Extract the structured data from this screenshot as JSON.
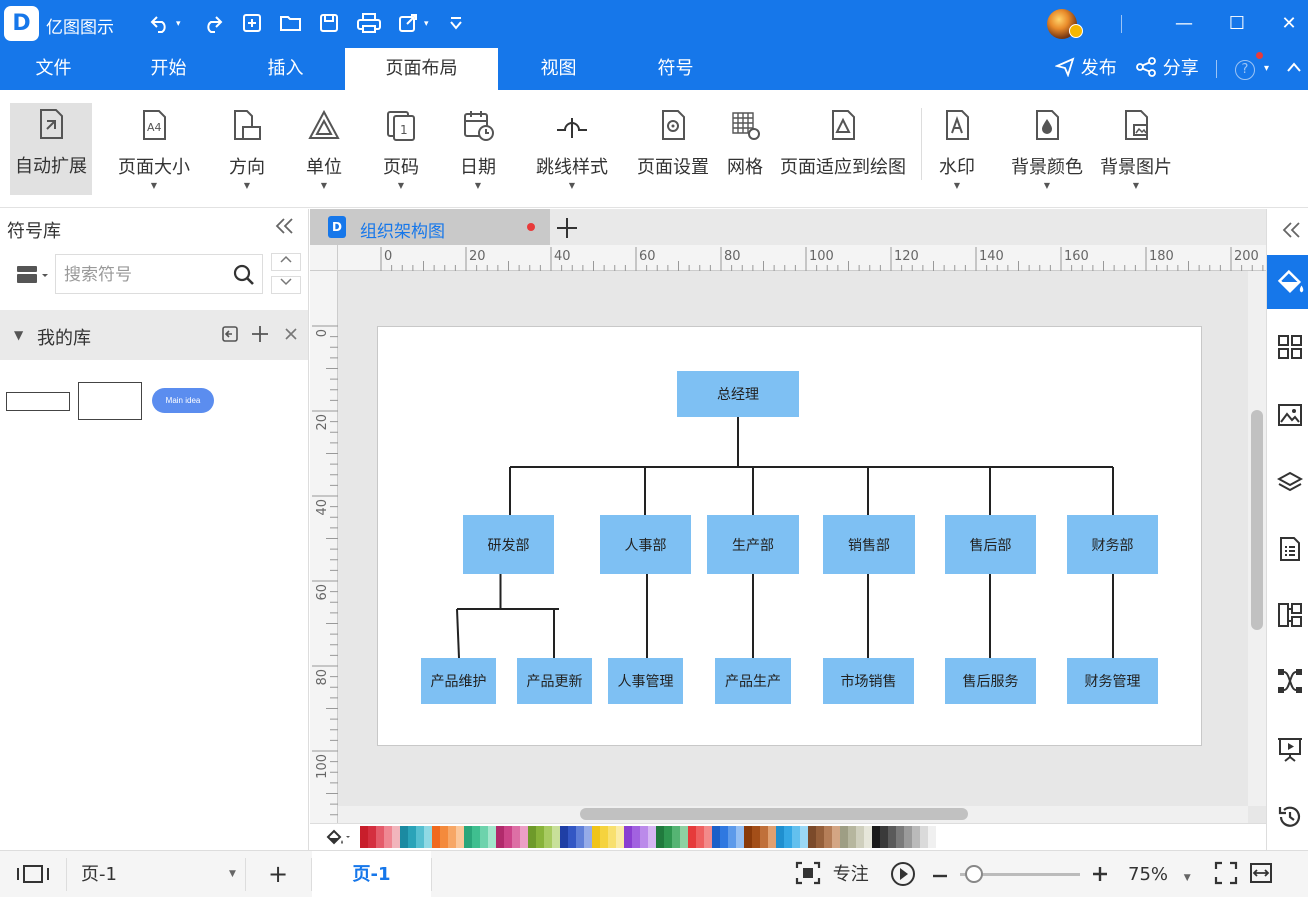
{
  "app": {
    "title": "亿图图示",
    "logo_letter": "D"
  },
  "quick_access": {
    "undo_icon": "undo-icon",
    "redo_icon": "redo-icon",
    "new_icon": "new-file-icon",
    "open_icon": "open-folder-icon",
    "save_icon": "save-icon",
    "print_icon": "print-icon",
    "export_icon": "export-icon",
    "customize_icon": "customize-icon"
  },
  "window": {
    "minimize": "—",
    "maximize": "☐",
    "close": "✕"
  },
  "menu": {
    "tabs": [
      "文件",
      "开始",
      "插入",
      "页面布局",
      "视图",
      "符号"
    ],
    "active_tab": "页面布局",
    "publish": "发布",
    "share": "分享",
    "help": "?"
  },
  "ribbon": {
    "buttons": [
      {
        "label": "自动扩展",
        "icon": "auto-extend-icon",
        "active": true,
        "dropdown": false
      },
      {
        "label": "页面大小",
        "icon": "page-size-icon",
        "dropdown": true
      },
      {
        "label": "方向",
        "icon": "orientation-icon",
        "dropdown": true
      },
      {
        "label": "单位",
        "icon": "unit-icon",
        "dropdown": true
      },
      {
        "label": "页码",
        "icon": "page-number-icon",
        "dropdown": true
      },
      {
        "label": "日期",
        "icon": "date-icon",
        "dropdown": true
      },
      {
        "label": "跳线样式",
        "icon": "jump-line-icon",
        "dropdown": true
      },
      {
        "label": "页面设置",
        "icon": "page-setup-icon",
        "dropdown": false
      },
      {
        "label": "网格",
        "icon": "grid-icon",
        "dropdown": false
      },
      {
        "label": "页面适应到绘图",
        "icon": "fit-page-icon",
        "dropdown": false
      },
      {
        "label": "水印",
        "icon": "watermark-icon",
        "dropdown": true
      },
      {
        "label": "背景颜色",
        "icon": "background-color-icon",
        "dropdown": true
      },
      {
        "label": "背景图片",
        "icon": "background-image-icon",
        "dropdown": true
      }
    ]
  },
  "symbol_library": {
    "title": "符号库",
    "search_placeholder": "搜索符号",
    "my_library": "我的库",
    "sample_shape_text": "Main idea"
  },
  "document": {
    "tab_title": "组织架构图",
    "unsaved": true
  },
  "rulers": {
    "horizontal_ticks": [
      "0",
      "20",
      "40",
      "60",
      "80",
      "100",
      "120",
      "140",
      "160",
      "180",
      "200"
    ],
    "vertical_ticks": [
      "0",
      "20",
      "40",
      "60",
      "80",
      "100"
    ]
  },
  "org_chart": {
    "root": "总经理",
    "departments": [
      {
        "name": "研发部",
        "children": [
          "产品维护",
          "产品更新"
        ]
      },
      {
        "name": "人事部",
        "children": [
          "人事管理"
        ]
      },
      {
        "name": "生产部",
        "children": [
          "产品生产"
        ]
      },
      {
        "name": "销售部",
        "children": [
          "市场销售"
        ]
      },
      {
        "name": "售后部",
        "children": [
          "售后服务"
        ]
      },
      {
        "name": "财务部",
        "children": [
          "财务管理"
        ]
      }
    ],
    "node_color": "#7ec0f3"
  },
  "palette": {
    "colors": [
      "#c81e2b",
      "#d42f3f",
      "#e45b6a",
      "#ef8793",
      "#f2b5bc",
      "#1b8aa1",
      "#2aa3b8",
      "#55bfd0",
      "#8fd9e4",
      "#f06a1f",
      "#f48a3c",
      "#f7a766",
      "#fbc79a",
      "#2aa67a",
      "#3fbf8f",
      "#6dd3ac",
      "#a3e6cc",
      "#b12a6b",
      "#cc4487",
      "#dd6fa5",
      "#ec9fc5",
      "#6e9a2a",
      "#88b33a",
      "#a8cb62",
      "#c8e09a",
      "#1f3fa5",
      "#3357c4",
      "#5f7fd8",
      "#95abe8",
      "#f0c419",
      "#f5d33e",
      "#f8e06f",
      "#fbeca5",
      "#8a3fd1",
      "#a262e0",
      "#bb8aea",
      "#d6b6f3",
      "#207a3d",
      "#2f9650",
      "#55b473",
      "#8fd1a2",
      "#e63b3b",
      "#ee6060",
      "#f38a8a",
      "#1b5fc8",
      "#2f78e0",
      "#5d9aea",
      "#95bff3",
      "#8a3a0a",
      "#a34e18",
      "#c0703a",
      "#e0a070",
      "#1f8fcf",
      "#35a7e4",
      "#63c0ee",
      "#9bd8f5",
      "#7b4a2a",
      "#955f3a",
      "#b57e58",
      "#d4a684",
      "#9e9e84",
      "#b6b69e",
      "#cfcfbd",
      "#e6e6da",
      "#1a1a1a",
      "#3a3a3a",
      "#5a5a5a",
      "#7a7a7a",
      "#9a9a9a",
      "#bababa",
      "#dadada",
      "#f0f0f0"
    ]
  },
  "right_sidebar": {
    "icons": [
      "style-fill-icon",
      "grid-layout-icon",
      "image-icon",
      "layers-icon",
      "page-list-icon",
      "org-chart-icon",
      "nodes-icon",
      "presentation-icon",
      "history-icon"
    ]
  },
  "status": {
    "page_selector": "页-1",
    "add_page": "+",
    "current_page_tab": "页-1",
    "focus_label": "专注",
    "zoom_level": "75%",
    "zoom_fraction": 0.12
  }
}
